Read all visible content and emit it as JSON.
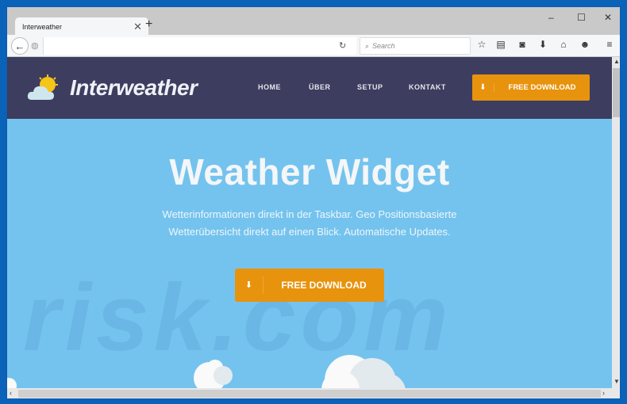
{
  "browser": {
    "tab_title": "Interweather",
    "tab_close": "✕",
    "new_tab": "+",
    "window_controls": {
      "minimize": "–",
      "maximize": "☐",
      "close": "✕"
    },
    "search_placeholder": "Search",
    "toolbar_icons": [
      "star-icon",
      "reading-list-icon",
      "pocket-icon",
      "download-icon",
      "home-icon",
      "hello-icon",
      "menu-icon"
    ]
  },
  "site": {
    "brand": "Interweather",
    "nav": [
      "HOME",
      "ÜBER",
      "SETUP",
      "KONTAKT"
    ],
    "header_button": "FREE DOWNLOAD",
    "hero_title": "Weather Widget",
    "hero_sub_line1": "Wetterinformationen direkt in der Taskbar. Geo Positionsbasierte",
    "hero_sub_line2": "Wetterübersicht direkt auf einen Blick. Automatische Updates.",
    "cta_button": "FREE DOWNLOAD",
    "watermark": "risk.com"
  },
  "colors": {
    "header_bg": "#3d3d5f",
    "hero_bg": "#74c3ee",
    "accent": "#e8930d"
  }
}
